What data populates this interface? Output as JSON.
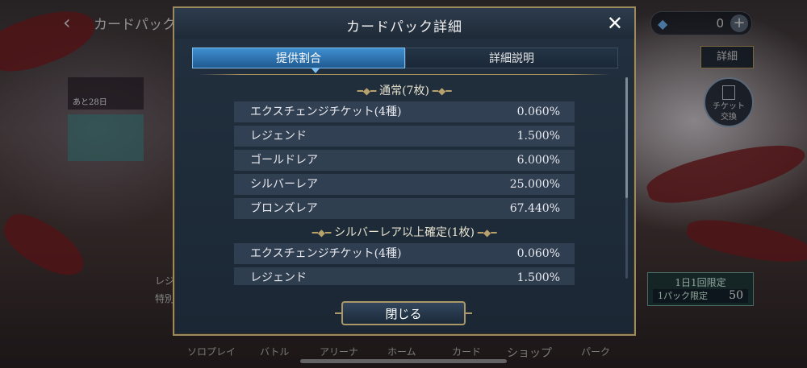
{
  "background": {
    "header_title": "カードパック",
    "currency_value": "0",
    "detail_label": "詳細",
    "ticket_label_1": "チケット",
    "ticket_label_2": "交換",
    "limit_title": "1日1回限定",
    "limit_sub": "1パック限定",
    "limit_price": "50",
    "banner_days": "あと28日",
    "side_label_1": "レジ",
    "side_label_2": "特別",
    "nav": [
      "ソロプレイ",
      "バトル",
      "アリーナ",
      "ホーム",
      "カード",
      "ショップ",
      "パーク"
    ]
  },
  "modal": {
    "title": "カードパック詳細",
    "close_icon": "close-icon",
    "tabs": [
      {
        "label": "提供割合",
        "active": true
      },
      {
        "label": "詳細説明",
        "active": false
      }
    ],
    "sections": [
      {
        "heading": "通常(7枚)",
        "rows": [
          {
            "name": "エクスチェンジチケット(4種)",
            "pct": "0.060%"
          },
          {
            "name": "レジェンド",
            "pct": "1.500%"
          },
          {
            "name": "ゴールドレア",
            "pct": "6.000%"
          },
          {
            "name": "シルバーレア",
            "pct": "25.000%"
          },
          {
            "name": "ブロンズレア",
            "pct": "67.440%"
          }
        ]
      },
      {
        "heading": "シルバーレア以上確定(1枚)",
        "rows": [
          {
            "name": "エクスチェンジチケット(4種)",
            "pct": "0.060%"
          },
          {
            "name": "レジェンド",
            "pct": "1.500%"
          }
        ]
      }
    ],
    "close_button_label": "閉じる"
  },
  "colors": {
    "tab_active": "#3f8fd0",
    "gold_border": "#9c8a5c",
    "panel_bg": "#1b2734"
  }
}
